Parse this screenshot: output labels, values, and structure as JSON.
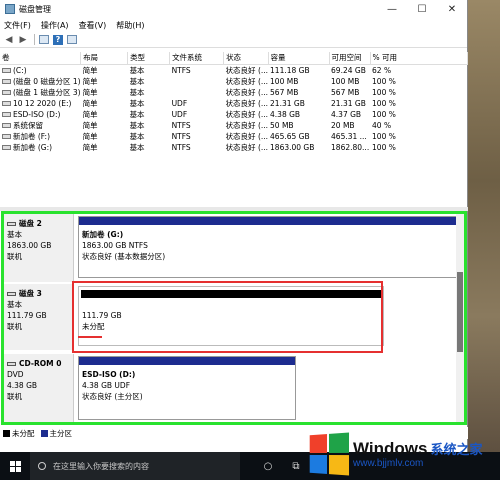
{
  "window": {
    "title": "磁盘管理",
    "controls": {
      "minimize": "—",
      "maximize": "☐",
      "close": "✕"
    }
  },
  "menu": [
    "文件(F)",
    "操作(A)",
    "查看(V)",
    "帮助(H)"
  ],
  "table": {
    "columns": [
      "卷",
      "布局",
      "类型",
      "文件系统",
      "状态",
      "容量",
      "可用空间",
      "% 可用"
    ],
    "rows": [
      [
        "(C:)",
        "简单",
        "基本",
        "NTFS",
        "状态良好 (...",
        "111.18 GB",
        "69.24 GB",
        "62 %"
      ],
      [
        "(磁盘 0 磁盘分区 1)",
        "简单",
        "基本",
        "",
        "状态良好 (...",
        "100 MB",
        "100 MB",
        "100 %"
      ],
      [
        "(磁盘 1 磁盘分区 3)",
        "简单",
        "基本",
        "",
        "状态良好 (...",
        "567 MB",
        "567 MB",
        "100 %"
      ],
      [
        "10 12 2020 (E:)",
        "简单",
        "基本",
        "UDF",
        "状态良好 (...",
        "21.31 GB",
        "21.31 GB",
        "100 %"
      ],
      [
        "ESD-ISO (D:)",
        "简单",
        "基本",
        "UDF",
        "状态良好 (...",
        "4.38 GB",
        "4.37 GB",
        "100 %"
      ],
      [
        "系统保留",
        "简单",
        "基本",
        "NTFS",
        "状态良好 (...",
        "50 MB",
        "20 MB",
        "40 %"
      ],
      [
        "新加卷 (F:)",
        "简单",
        "基本",
        "NTFS",
        "状态良好 (...",
        "465.65 GB",
        "465.31 ...",
        "100 %"
      ],
      [
        "新加卷 (G:)",
        "简单",
        "基本",
        "NTFS",
        "状态良好 (...",
        "1863.00 GB",
        "1862.80...",
        "100 %"
      ]
    ]
  },
  "disks": [
    {
      "name": "磁盘 2",
      "type": "基本",
      "size": "1863.00 GB",
      "status": "联机",
      "partition": {
        "title": "新加卷 (G:)",
        "line1": "1863.00 GB NTFS",
        "line2": "状态良好 (基本数据分区)"
      }
    },
    {
      "name": "磁盘 3",
      "type": "基本",
      "size": "111.79 GB",
      "status": "联机",
      "partition": {
        "title": "",
        "line1": "111.79 GB",
        "line2": "未分配"
      }
    },
    {
      "name": "CD-ROM 0",
      "type": "DVD",
      "size": "4.38 GB",
      "status": "联机",
      "partition": {
        "title": "ESD-ISO (D:)",
        "line1": "4.38 GB UDF",
        "line2": "状态良好 (主分区)"
      }
    }
  ],
  "legend": [
    {
      "label": "未分配",
      "color": "#000000"
    },
    {
      "label": "主分区",
      "color": "#1d2c8f"
    }
  ],
  "taskbar": {
    "search_placeholder": "在这里输入你要搜索的内容"
  },
  "watermark": {
    "brand": "Windows",
    "cn": "系统之家",
    "url": "www.bjjmlv.com"
  },
  "colors": {
    "highlight_green": "#29e22e",
    "highlight_red": "#e53030",
    "partition_bar": "#1d2c8f",
    "unallocated_bar": "#000000"
  }
}
